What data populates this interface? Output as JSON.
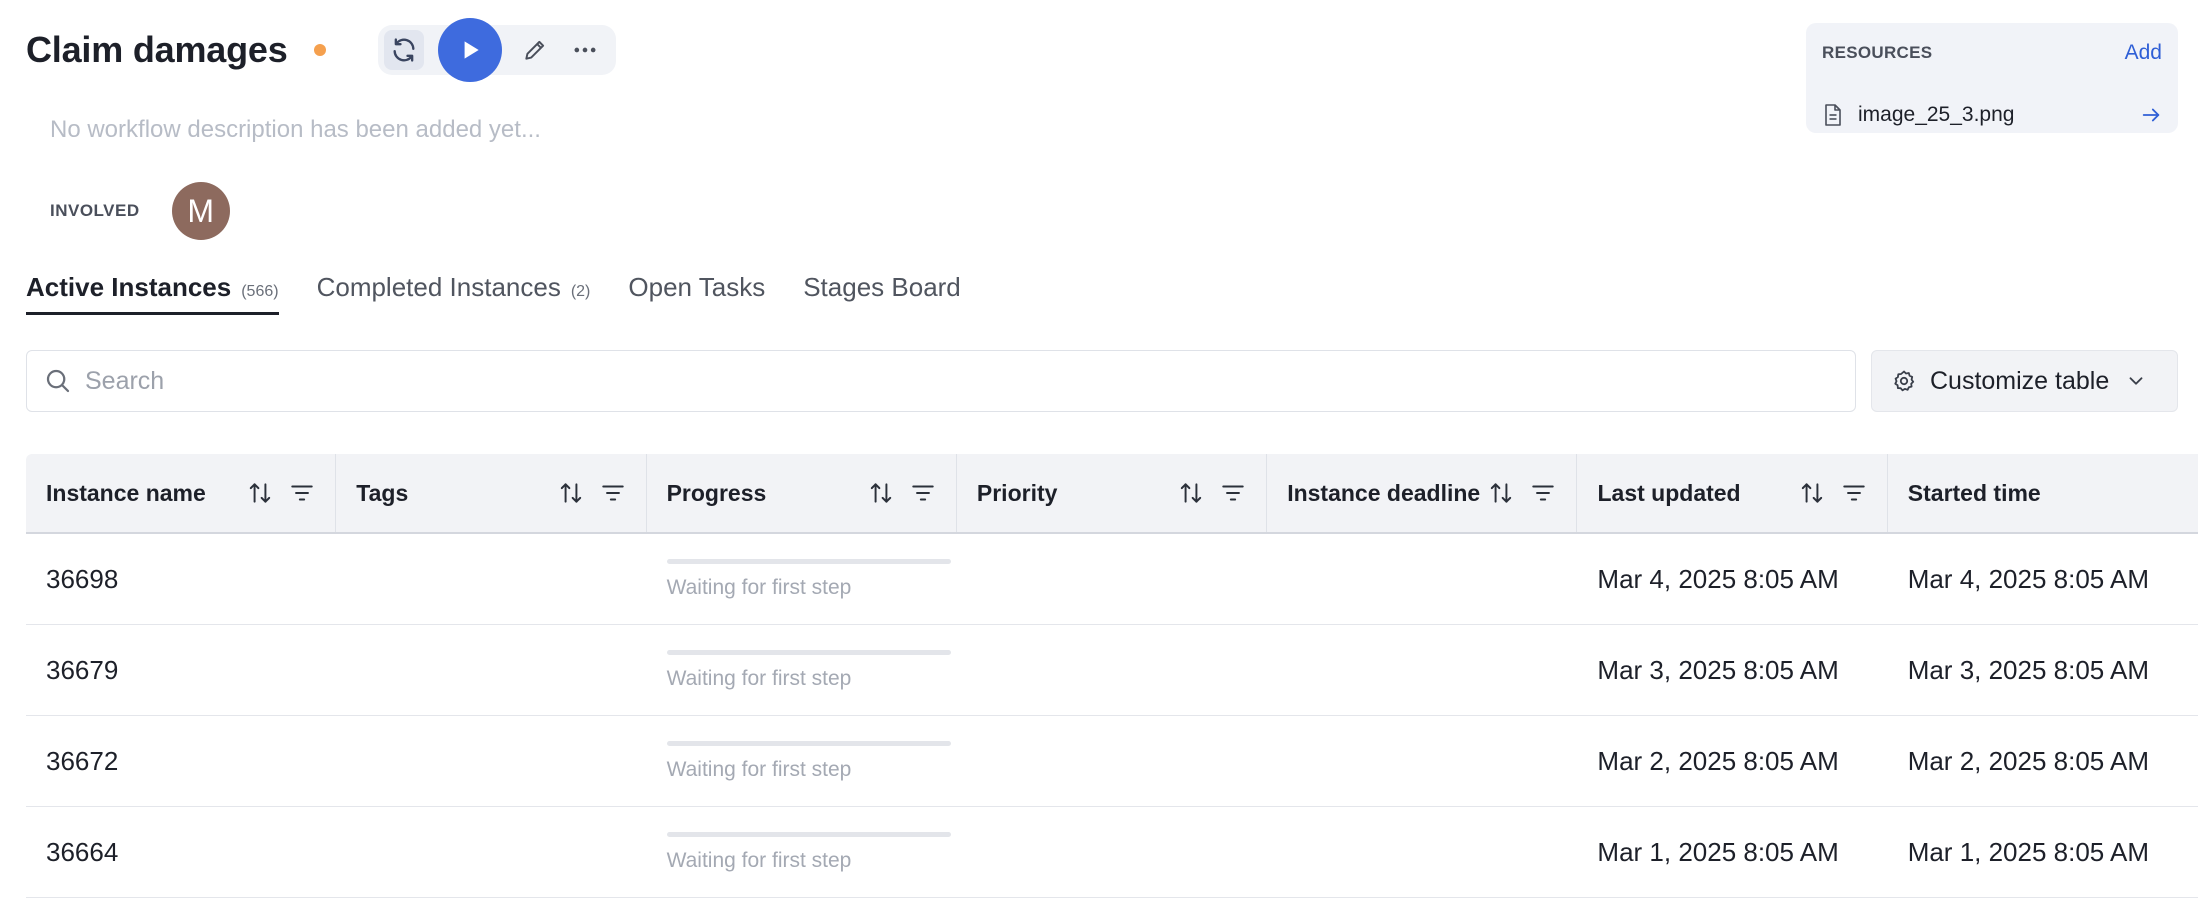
{
  "workflow": {
    "title": "Claim damages",
    "description_placeholder": "No workflow description has been added yet...",
    "involved_label": "INVOLVED",
    "avatar_initial": "M"
  },
  "resources": {
    "title": "RESOURCES",
    "add_label": "Add",
    "files": [
      {
        "name": "image_25_3.png"
      }
    ]
  },
  "tabs": [
    {
      "label": "Active Instances",
      "count": "(566)",
      "active": true
    },
    {
      "label": "Completed Instances",
      "count": "(2)",
      "active": false
    },
    {
      "label": "Open Tasks",
      "count": "",
      "active": false
    },
    {
      "label": "Stages Board",
      "count": "",
      "active": false
    }
  ],
  "search": {
    "placeholder": "Search"
  },
  "customize": {
    "label": "Customize table"
  },
  "table": {
    "columns": [
      {
        "label": "Instance name",
        "sortable": true,
        "filterable": true
      },
      {
        "label": "Tags",
        "sortable": true,
        "filterable": true
      },
      {
        "label": "Progress",
        "sortable": true,
        "filterable": true
      },
      {
        "label": "Priority",
        "sortable": true,
        "filterable": true
      },
      {
        "label": "Instance deadline",
        "sortable": true,
        "filterable": true
      },
      {
        "label": "Last updated",
        "sortable": true,
        "filterable": true
      },
      {
        "label": "Started time",
        "sortable": false,
        "filterable": false
      }
    ],
    "rows": [
      {
        "name": "36698",
        "tags": "",
        "progress": 0,
        "progress_text": "Waiting for first step",
        "priority": "",
        "deadline": "",
        "last_updated": "Mar 4, 2025 8:05 AM",
        "started": "Mar 4, 2025 8:05 AM"
      },
      {
        "name": "36679",
        "tags": "",
        "progress": 0,
        "progress_text": "Waiting for first step",
        "priority": "",
        "deadline": "",
        "last_updated": "Mar 3, 2025 8:05 AM",
        "started": "Mar 3, 2025 8:05 AM"
      },
      {
        "name": "36672",
        "tags": "",
        "progress": 0,
        "progress_text": "Waiting for first step",
        "priority": "",
        "deadline": "",
        "last_updated": "Mar 2, 2025 8:05 AM",
        "started": "Mar 2, 2025 8:05 AM"
      },
      {
        "name": "36664",
        "tags": "",
        "progress": 0,
        "progress_text": "Waiting for first step",
        "priority": "",
        "deadline": "",
        "last_updated": "Mar 1, 2025 8:05 AM",
        "started": "Mar 1, 2025 8:05 AM"
      }
    ]
  },
  "colors": {
    "accent": "#3e6bde",
    "status_dot": "#f5a04e",
    "avatar_bg": "#8d6a5e"
  },
  "icons": {
    "sync": "sync-icon",
    "play": "play-icon",
    "edit": "pencil-icon",
    "more": "more-horizontal-icon",
    "file": "file-icon",
    "arrow": "arrow-right-icon",
    "search": "search-icon",
    "gear": "gear-icon",
    "chevron": "chevron-down-icon",
    "sort": "sort-icon",
    "filter": "filter-icon"
  }
}
